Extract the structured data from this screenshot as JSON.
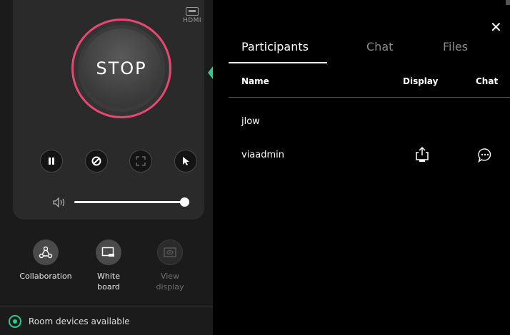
{
  "left_panel": {
    "hdmi_label": "HDMI",
    "stop_label": "STOP",
    "tools": [
      {
        "label_line1": "Collaboration",
        "label_line2": ""
      },
      {
        "label_line1": "White",
        "label_line2": "board"
      },
      {
        "label_line1": "View",
        "label_line2": "display"
      }
    ],
    "volume_level_percent": 100,
    "room_status": "Room devices available"
  },
  "right_panel": {
    "tabs": [
      {
        "label": "Participants",
        "active": true
      },
      {
        "label": "Chat",
        "active": false
      },
      {
        "label": "Files",
        "active": false
      }
    ],
    "columns": {
      "name": "Name",
      "display": "Display",
      "chat": "Chat"
    },
    "participants": [
      {
        "name": "jlow",
        "has_display": false,
        "has_chat": false
      },
      {
        "name": "viaadmin",
        "has_display": true,
        "has_chat": true
      }
    ],
    "close_glyph": "✕"
  },
  "colors": {
    "accent_green": "#2ecc8a",
    "stop_ring": "#e6486f",
    "panel_dark": "#1b1b1b",
    "card": "#2a2a2a"
  },
  "icons": [
    "hdmi-icon",
    "pause-icon",
    "block-icon",
    "fullscreen-icon",
    "pointer-icon",
    "volume-icon",
    "collaboration-icon",
    "whiteboard-icon",
    "view-display-icon",
    "room-devices-icon",
    "share-display-icon",
    "chat-bubble-icon",
    "close-icon"
  ]
}
